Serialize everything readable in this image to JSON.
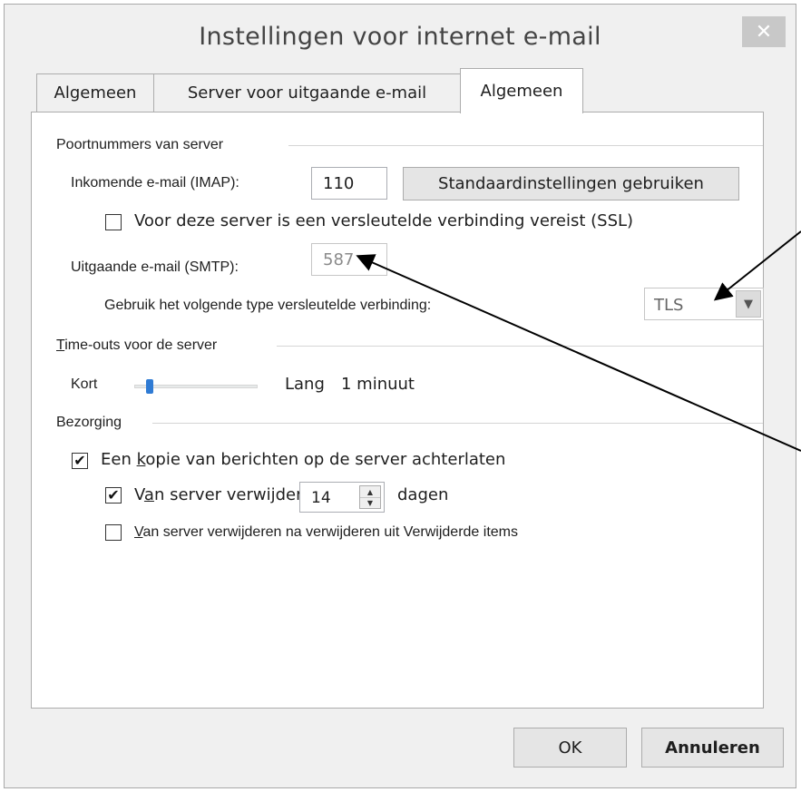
{
  "window": {
    "title": "Instellingen voor internet e-mail",
    "close_glyph": "✕"
  },
  "tabs": [
    {
      "label": "Algemeen",
      "active": false
    },
    {
      "label": "Server voor uitgaande e-mail",
      "active": false
    },
    {
      "label": "Algemeen",
      "active": true
    }
  ],
  "ports": {
    "group_label": "Poortnummers van server",
    "incoming_label": "Inkomende e-mail (IMAP):",
    "incoming_value": "110",
    "default_button": "Standaardinstellingen gebruiken",
    "ssl_label": "Voor deze server is een versleutelde verbinding vereist (SSL)",
    "ssl_checked": false,
    "outgoing_label": "Uitgaande e-mail (SMTP):",
    "outgoing_value": "587",
    "encryption_label": "Gebruik het volgende type versleutelde verbinding:",
    "encryption_value": "TLS"
  },
  "timeouts": {
    "group_label_first": "T",
    "group_label_rest": "ime-outs voor de server",
    "short_label": "Kort",
    "long_label": "Lang",
    "value_text": "1 minuut",
    "slider_fraction": 0.1
  },
  "delivery": {
    "group_label": "Bezorging",
    "keep_copy": {
      "pre": "Een ",
      "accel": "k",
      "post": "opie van berichten op de server achterlaten",
      "checked": true
    },
    "remove_after": {
      "pre": "V",
      "accel": "a",
      "post": "n server verwijderen na",
      "checked": true,
      "days": "14",
      "unit": "dagen"
    },
    "remove_deleted": {
      "accel": "V",
      "post": "an server verwijderen na verwijderen uit Verwijderde items",
      "checked": false
    }
  },
  "buttons": {
    "ok": "OK",
    "cancel": "Annuleren"
  },
  "colors": {
    "dialog_bg": "#f0f0f0",
    "panel_bg": "#ffffff",
    "slider_thumb": "#2f7bd4",
    "close_bg": "#c8c8c8"
  },
  "icons": {
    "close": "close-icon",
    "dropdown": "chevron-down-icon",
    "spin_up": "triangle-up-icon",
    "spin_down": "triangle-down-icon",
    "checkmark": "checkmark-icon"
  }
}
